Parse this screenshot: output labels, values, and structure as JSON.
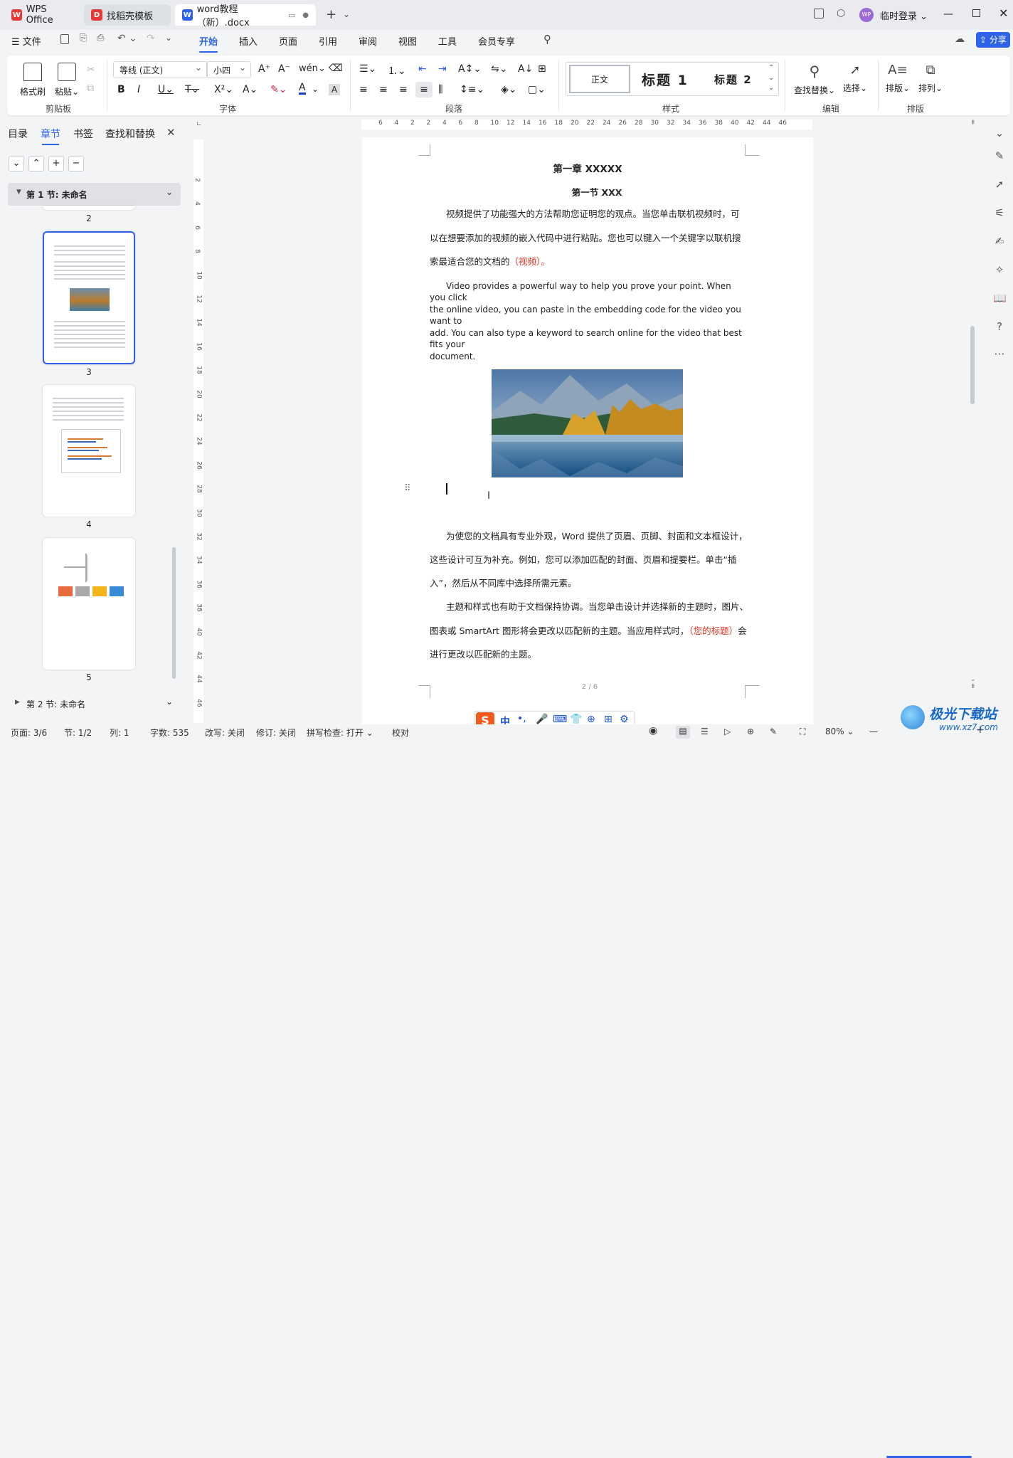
{
  "titlebar": {
    "tabs": [
      {
        "label": "WPS Office",
        "icon": "wps-logo-icon"
      },
      {
        "label": "找稻壳模板",
        "icon": "docer-icon"
      },
      {
        "label": "word教程（新）.docx",
        "icon": "word-doc-icon"
      }
    ],
    "login": "临时登录",
    "avatar": "WP"
  },
  "menubar": {
    "file": "文件",
    "items": [
      "开始",
      "插入",
      "页面",
      "引用",
      "审阅",
      "视图",
      "工具",
      "会员专享"
    ],
    "active": "开始",
    "share": "分享"
  },
  "ribbon": {
    "clipboard": {
      "format_painter": "格式刷",
      "paste": "粘贴",
      "group": "剪贴板"
    },
    "font": {
      "family": "等线 (正文)",
      "size": "小四",
      "group": "字体"
    },
    "paragraph": {
      "group": "段落"
    },
    "styles": {
      "normal": "正文",
      "h1": "标题 1",
      "h2": "标题 2",
      "group": "样式"
    },
    "edit": {
      "find_replace": "查找替换",
      "select": "选择",
      "group": "编辑"
    },
    "arrange": {
      "layout": "排版",
      "order": "排列",
      "group": "排版"
    }
  },
  "leftpanel": {
    "tabs": [
      "目录",
      "章节",
      "书签",
      "查找和替换"
    ],
    "active_tab": "章节",
    "section1": "第 1 节: 未命名",
    "section2": "第 2 节: 未命名",
    "page_numbers": [
      "2",
      "3",
      "4",
      "5"
    ]
  },
  "ruler": {
    "h_ticks": [
      "6",
      "4",
      "2",
      "2",
      "4",
      "6",
      "8",
      "10",
      "12",
      "14",
      "16",
      "18",
      "20",
      "22",
      "24",
      "26",
      "28",
      "30",
      "32",
      "34",
      "36",
      "38",
      "40",
      "42",
      "44",
      "46"
    ],
    "v_ticks": [
      "2",
      "4",
      "6",
      "8",
      "10",
      "12",
      "14",
      "16",
      "18",
      "20",
      "22",
      "24",
      "26",
      "28",
      "30",
      "32",
      "34",
      "36",
      "38",
      "40",
      "42",
      "44",
      "46"
    ]
  },
  "document": {
    "chapter": "第一章  XXXXX",
    "section": "第一节  XXX",
    "p1_lines": [
      "视频提供了功能强大的方法帮助您证明您的观点。当您单击联机视频时，可",
      "以在想要添加的视频的嵌入代码中进行粘贴。您也可以键入一个关键字以联机搜",
      "索最适合您的文档的"
    ],
    "p1_red": "（视频）。",
    "p2_lines": [
      "Video provides a powerful way to help you prove your point. When you click",
      "the online video, you can paste in the embedding code for the video you want to",
      "add. You can also type a keyword to search online for the video that best fits your",
      "document."
    ],
    "p3_lines": [
      "为使您的文档具有专业外观，Word 提供了页眉、页脚、封面和文本框设计，",
      "这些设计可互为补充。例如，您可以添加匹配的封面、页眉和提要栏。单击“插",
      "入”，然后从不同库中选择所需元素。"
    ],
    "p4_lines": [
      "主题和样式也有助于文档保持协调。当您单击设计并选择新的主题时，图片、",
      "图表或  SmartArt  图形将会更改以匹配新的主题。当应用样式时，",
      "进行更改以匹配新的主题。"
    ],
    "p4_red": "（您的标题）",
    "p4_after": "会",
    "page_footer": "2 / 6"
  },
  "status": {
    "page": "页面: 3/6",
    "section": "节: 1/2",
    "column": "列: 1",
    "words": "字数: 535",
    "overwrite": "改写: 关闭",
    "revise": "修订: 关闭",
    "spell": "拼写检查: 打开",
    "proof": "校对",
    "zoom": "80%"
  },
  "ime": {
    "label": "中"
  },
  "watermark": {
    "text": "极光下载站",
    "url": "www.xz7.com"
  },
  "colors": {
    "accent": "#2e63e8",
    "red_text": "#e0301e",
    "wps_red": "#e53935"
  }
}
